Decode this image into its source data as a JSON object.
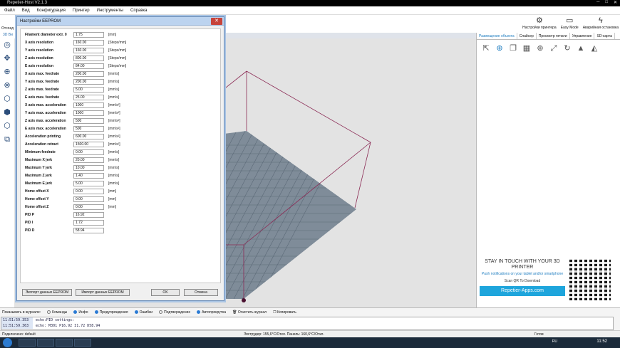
{
  "window": {
    "title": "Repetier-Host V2.1.3"
  },
  "menu": [
    "Файл",
    "Вид",
    "Конфигурация",
    "Принтер",
    "Инструменты",
    "Справка"
  ],
  "toolbar": {
    "printer_settings": "Настройки принтера",
    "easy_mode": "Easy Mode",
    "emergency_stop": "Аварийная остановка",
    "left_cut": "Отсоед"
  },
  "view_tab": "3D Ви",
  "right_tabs": [
    "Размещение объекта",
    "Слайсер",
    "Просмотр печати",
    "Управление",
    "SD-карта"
  ],
  "promo": {
    "heading": "STAY IN TOUCH WITH YOUR 3D PRINTER",
    "sub": "Push notifications on your tablet and/or smartphone",
    "qr_note": "Scan QR To Download",
    "button": "Repetier-Apps.com"
  },
  "log": {
    "show_label": "Показывать в журнале:",
    "filters": [
      {
        "label": "Команды",
        "on": false
      },
      {
        "label": "Инфо",
        "on": true
      },
      {
        "label": "Предупреждения",
        "on": true
      },
      {
        "label": "Ошибки",
        "on": true
      },
      {
        "label": "Подтверждение",
        "on": false
      },
      {
        "label": "Автопрокрутка",
        "on": true
      }
    ],
    "clear": "Очистить журнал",
    "copy": "Копировать",
    "lines": [
      {
        "time": "11:51:59.353",
        "text": "echo:PID settings:"
      },
      {
        "time": "11:51:59.363",
        "text": "echo:  M301 P16.92 I1.72 D58.94"
      }
    ]
  },
  "status": {
    "connection": "Подключено: default",
    "temps": "Экструдер: 155,6°C/Откл. Панель: 160,6°C/Откл.",
    "ready": "Готов"
  },
  "taskbar": {
    "lang": "RU",
    "clock": "11:52"
  },
  "eeprom": {
    "title": "Настройки EEPROM",
    "close": "✕",
    "rows": [
      {
        "label": "Filament diameter extr. 0",
        "value": "1.75",
        "unit": "[mm]"
      },
      {
        "label": "X axis resolution",
        "value": "160.00",
        "unit": "[Steps/mm]"
      },
      {
        "label": "Y axis resolution",
        "value": "160.00",
        "unit": "[Steps/mm]"
      },
      {
        "label": "Z axis resolution",
        "value": "800.00",
        "unit": "[Steps/mm]"
      },
      {
        "label": "E axis resolution",
        "value": "84.00",
        "unit": "[Steps/mm]"
      },
      {
        "label": "X axis max. feedrate",
        "value": "200.00",
        "unit": "[mm/s]"
      },
      {
        "label": "Y axis max. feedrate",
        "value": "200.00",
        "unit": "[mm/s]"
      },
      {
        "label": "Z axis max. feedrate",
        "value": "5.00",
        "unit": "[mm/s]"
      },
      {
        "label": "E axis max. feedrate",
        "value": "25.00",
        "unit": "[mm/s]"
      },
      {
        "label": "X axis max. acceleration",
        "value": "1000",
        "unit": "[mm/s²]"
      },
      {
        "label": "Y axis max. acceleration",
        "value": "1000",
        "unit": "[mm/s²]"
      },
      {
        "label": "Z axis max. acceleration",
        "value": "500",
        "unit": "[mm/s²]"
      },
      {
        "label": "E axis max. acceleration",
        "value": "500",
        "unit": "[mm/s²]"
      },
      {
        "label": "Acceleration printing",
        "value": "600.00",
        "unit": "[mm/s²]"
      },
      {
        "label": "Acceleration retract",
        "value": "1500.00",
        "unit": "[mm/s²]"
      },
      {
        "label": "Minimum feedrate",
        "value": "0.00",
        "unit": "[mm/s]"
      },
      {
        "label": "Maximum X jerk",
        "value": "20.00",
        "unit": "[mm/s]"
      },
      {
        "label": "Maximum Y jerk",
        "value": "10.00",
        "unit": "[mm/s]"
      },
      {
        "label": "Maximum Z jerk",
        "value": "1.40",
        "unit": "[mm/s]"
      },
      {
        "label": "Maximum E jerk",
        "value": "5.00",
        "unit": "[mm/s]"
      },
      {
        "label": "Home offset X",
        "value": "0.00",
        "unit": "[mm]"
      },
      {
        "label": "Home offset Y",
        "value": "0.00",
        "unit": "[mm]"
      },
      {
        "label": "Home offset Z",
        "value": "0.00",
        "unit": "[mm]"
      },
      {
        "label": "PID P",
        "value": "16.92",
        "unit": ""
      },
      {
        "label": "PID I",
        "value": "1.72",
        "unit": ""
      },
      {
        "label": "PID D",
        "value": "58.94",
        "unit": ""
      }
    ],
    "export": "Экспорт данных EEPROM",
    "import": "Импорт данных EEPROM",
    "ok": "OK",
    "cancel": "Отмена"
  },
  "icons": {
    "toolbar": [
      "gear-icon",
      "easy-mode-icon",
      "emergency-stop-icon"
    ],
    "left": [
      "rotate-view-icon",
      "move-view-icon",
      "zoom-icon",
      "fit-view-icon",
      "iso-view-icon",
      "front-view-icon",
      "top-view-icon",
      "side-view-icon"
    ],
    "right": [
      "export-icon",
      "add-object-icon",
      "copy-icon",
      "autoplace-icon",
      "center-icon",
      "scale-icon",
      "rotate-icon",
      "cut-icon",
      "mirror-icon"
    ]
  },
  "colors": {
    "accent": "#1e7dc0",
    "bed": "#7f8c99",
    "frame": "#8b2b55",
    "promo_button": "#1ea5dc"
  }
}
